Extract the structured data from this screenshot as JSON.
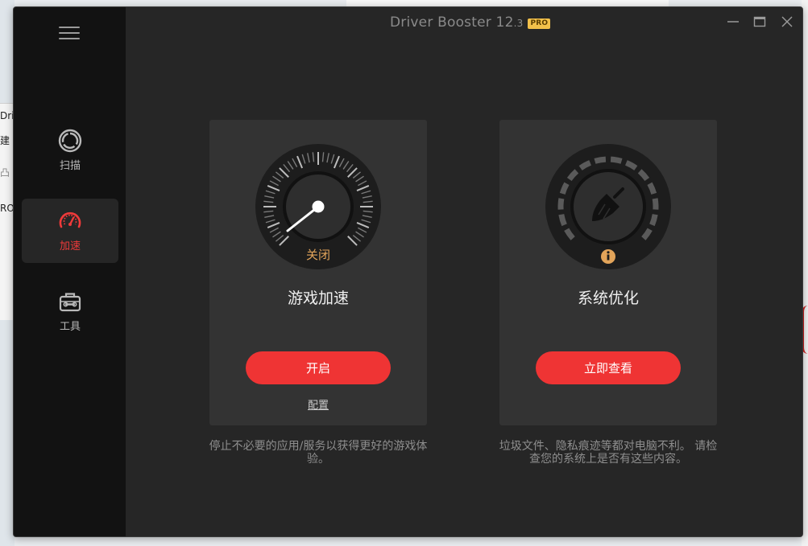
{
  "background": {
    "left_fragments": [
      "Driv",
      "建",
      "凸",
      "RO"
    ]
  },
  "window": {
    "title": "Driver Booster 12",
    "version_suffix": ".3",
    "badge": "PRO",
    "controls": {
      "minimize_icon": "minimize-icon",
      "maximize_icon": "maximize-icon",
      "close_icon": "close-icon"
    }
  },
  "sidebar": {
    "menu_icon": "hamburger-icon",
    "items": [
      {
        "label": "扫描",
        "icon": "scan-icon",
        "active": false
      },
      {
        "label": "加速",
        "icon": "speedometer-icon",
        "active": true
      },
      {
        "label": "工具",
        "icon": "toolbox-icon",
        "active": false
      }
    ]
  },
  "cards": {
    "game_boost": {
      "title": "游戏加速",
      "status": "关闭",
      "button": "开启",
      "link": "配置",
      "description": "停止不必要的应用/服务以获得更好的游戏体验。"
    },
    "system_optimize": {
      "title": "系统优化",
      "status_icon": "info-icon",
      "button": "立即查看",
      "description": "垃圾文件、隐私痕迹等都对电脑不利。 请检查您的系统上是否有这些内容。"
    }
  },
  "colors": {
    "accent": "#ef3434",
    "status_orange": "#e2a45a",
    "badge": "#f2c04a",
    "window_bg": "#262626",
    "sidebar_bg": "#121212",
    "card_bg": "#333333"
  }
}
